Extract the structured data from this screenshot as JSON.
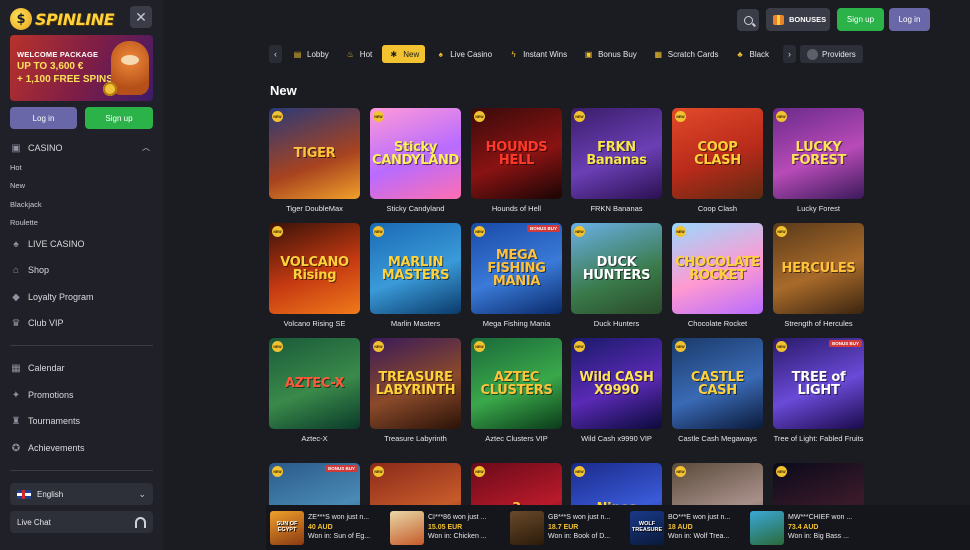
{
  "brand": {
    "name": "SPINLINE"
  },
  "sidebar": {
    "promo": {
      "line1": "WELCOME PACKAGE",
      "line2": "UP TO 3,600 €",
      "line3": "+ 1,100 FREE SPINS"
    },
    "login_label": "Log in",
    "signup_label": "Sign up",
    "casino_label": "CASINO",
    "casino_subitems": [
      "Hot",
      "New",
      "Blackjack",
      "Roulette"
    ],
    "nav": [
      {
        "label": "LIVE CASINO",
        "icon": "live-casino-icon"
      },
      {
        "label": "Shop",
        "icon": "shop-icon"
      },
      {
        "label": "Loyalty Program",
        "icon": "loyalty-icon"
      },
      {
        "label": "Club VIP",
        "icon": "crown-icon"
      }
    ],
    "nav2": [
      {
        "label": "Calendar",
        "icon": "calendar-icon"
      },
      {
        "label": "Promotions",
        "icon": "promotions-icon"
      },
      {
        "label": "Tournaments",
        "icon": "trophy-icon"
      },
      {
        "label": "Achievements",
        "icon": "achievements-icon"
      }
    ],
    "language": "English",
    "live_chat": "Live Chat"
  },
  "header": {
    "bonuses_label": "BONUSES",
    "signup_label": "Sign up",
    "login_label": "Log in"
  },
  "categories": [
    {
      "label": "Lobby",
      "icon": "lobby-icon",
      "active": false
    },
    {
      "label": "Hot",
      "icon": "flame-icon",
      "active": false
    },
    {
      "label": "New",
      "icon": "new-icon",
      "active": true
    },
    {
      "label": "Live Casino",
      "icon": "live-casino-icon",
      "active": false
    },
    {
      "label": "Instant Wins",
      "icon": "lightning-icon",
      "active": false
    },
    {
      "label": "Bonus Buy",
      "icon": "bonus-buy-icon",
      "active": false
    },
    {
      "label": "Scratch Cards",
      "icon": "scratch-card-icon",
      "active": false
    },
    {
      "label": "Black",
      "icon": "blackjack-icon",
      "active": false
    }
  ],
  "providers_label": "Providers",
  "section_title": "New",
  "badges": {
    "new": "NEW",
    "bonus_buy": "BONUS BUY"
  },
  "games": [
    {
      "name": "Tiger DoubleMax",
      "art": "TIGER",
      "bg": "linear-gradient(160deg,#2b3a78,#a8431f 60%,#f0a02a)",
      "fg": "#ffc23a",
      "bonus": false
    },
    {
      "name": "Sticky Candyland",
      "art": "Sticky CANDYLAND",
      "bg": "linear-gradient(160deg,#ff9ad8,#b86bff 55%,#ff6fb0)",
      "fg": "#ffef5a",
      "bonus": false
    },
    {
      "name": "Hounds of Hell",
      "art": "HOUNDS HELL",
      "bg": "linear-gradient(160deg,#3a0a0a,#8a1313 55%,#1a0505)",
      "fg": "#ff3a2a",
      "bonus": false
    },
    {
      "name": "FRKN Bananas",
      "art": "FRKN Bananas",
      "bg": "linear-gradient(160deg,#3a1d6a,#6b3fb5 55%,#2a1050)",
      "fg": "#f6e64a",
      "bonus": false
    },
    {
      "name": "Coop Clash",
      "art": "COOP CLASH",
      "bg": "linear-gradient(160deg,#e24a2a,#b82a1a 55%,#5c2a12)",
      "fg": "#ffd23a",
      "bonus": false
    },
    {
      "name": "Lucky Forest",
      "art": "LUCKY FOREST",
      "bg": "linear-gradient(160deg,#6a2a8a,#b84bb8 55%,#3a1a5a)",
      "fg": "#ffe15a",
      "bonus": false
    },
    {
      "name": "Volcano Rising SE",
      "art": "VOLCANO Rising",
      "bg": "linear-gradient(160deg,#3a1208,#c63a12 55%,#f07a1a)",
      "fg": "#ffd23a",
      "bonus": false
    },
    {
      "name": "Marlin Masters",
      "art": "MARLIN MASTERS",
      "bg": "linear-gradient(160deg,#1a6ab5,#3a9ad8 55%,#0a3a6a)",
      "fg": "#ffd23a",
      "bonus": false
    },
    {
      "name": "Mega Fishing Mania",
      "art": "MEGA FISHING MANIA",
      "bg": "linear-gradient(160deg,#1a4aa8,#3a7ad8 55%,#0a2a6a)",
      "fg": "#ffc23a",
      "bonus": true
    },
    {
      "name": "Duck Hunters",
      "art": "DUCK HUNTERS",
      "bg": "linear-gradient(160deg,#6ab0e8,#3a7a4a 60%,#2a4a2a)",
      "fg": "#ffffff",
      "bonus": false
    },
    {
      "name": "Chocolate Rocket",
      "art": "CHOCOLATE ROCKET",
      "bg": "linear-gradient(160deg,#9ad8ff,#ff9ad0 55%,#b86bff)",
      "fg": "#ffd23a",
      "bonus": false
    },
    {
      "name": "Strength of Hercules",
      "art": "HERCULES",
      "bg": "linear-gradient(160deg,#5a3a1a,#a86a2a 55%,#3a2410)",
      "fg": "#ffc23a",
      "bonus": false
    },
    {
      "name": "Aztec-X",
      "art": "AZTEC-X",
      "bg": "linear-gradient(160deg,#1a5a3a,#3a8a4a 55%,#0a3a2a)",
      "fg": "#ff5a3a",
      "bonus": false
    },
    {
      "name": "Treasure Labyrinth",
      "art": "TREASURE LABYRINTH",
      "bg": "linear-gradient(160deg,#3a1a5a,#8a4a2a 55%,#2a1208)",
      "fg": "#ffd23a",
      "bonus": false
    },
    {
      "name": "Aztec Clusters VIP",
      "art": "AZTEC CLUSTERS",
      "bg": "linear-gradient(160deg,#1a6a3a,#3aa84a 55%,#0a3a1a)",
      "fg": "#ffc23a",
      "bonus": false
    },
    {
      "name": "Wild Cash x9990 VIP",
      "art": "Wild CASH X9990",
      "bg": "linear-gradient(160deg,#1a1a6a,#5a2ab5 55%,#0a0a3a)",
      "fg": "#ffe15a",
      "bonus": false
    },
    {
      "name": "Castle Cash Megaways",
      "art": "CASTLE CASH",
      "bg": "linear-gradient(160deg,#1a3a6a,#3a6ab5 55%,#0a1a3a)",
      "fg": "#ffd23a",
      "bonus": false
    },
    {
      "name": "Tree of Light: Fabled Fruits",
      "art": "TREE of LIGHT",
      "bg": "linear-gradient(160deg,#2a1a6a,#6a4ad8 55%,#1a0a4a)",
      "fg": "#ffffff",
      "bonus": true
    },
    {
      "name": "",
      "art": "",
      "bg": "linear-gradient(160deg,#2a5a8a,#4a8ab5 55%,#1a3a5a)",
      "fg": "#ffd23a",
      "bonus": true
    },
    {
      "name": "",
      "art": "",
      "bg": "linear-gradient(160deg,#8a2a1a,#c65a2a 55%,#3a1208)",
      "fg": "#ffd23a",
      "bonus": false
    },
    {
      "name": "",
      "art": "3",
      "bg": "linear-gradient(160deg,#6a0a1a,#b81a2a 55%,#3a0510)",
      "fg": "#ffc23a",
      "bonus": false
    },
    {
      "name": "",
      "art": "Nines",
      "bg": "linear-gradient(160deg,#1a2a8a,#3a5ad8 55%,#0a1a5a)",
      "fg": "#ffd23a",
      "bonus": false
    },
    {
      "name": "",
      "art": "",
      "bg": "linear-gradient(160deg,#5a4a3a,#a8908a 55%,#3a2a2a)",
      "fg": "#ffffff",
      "bonus": false
    },
    {
      "name": "",
      "art": "",
      "bg": "linear-gradient(160deg,#0a0a1a,#3a1a2a 55%,#1a0a0a)",
      "fg": "#ff3a3a",
      "bonus": false
    }
  ],
  "ticker": [
    {
      "user": "ZE***S won just n...",
      "amount": "40 AUD",
      "game": "Won in: Sun of Eg...",
      "art": "SUN OF EGYPT",
      "bg": "linear-gradient(160deg,#f0a02a,#8a3a12)"
    },
    {
      "user": "CI***86 won just ...",
      "amount": "15.05 EUR",
      "game": "Won in: Chicken ...",
      "art": "",
      "bg": "linear-gradient(160deg,#e8d8a8,#c65a2a)"
    },
    {
      "user": "GB***S won just n...",
      "amount": "18.7 EUR",
      "game": "Won in: Book of D...",
      "art": "",
      "bg": "linear-gradient(160deg,#6a4a2a,#2a1a0a)"
    },
    {
      "user": "BO***E won just n...",
      "amount": "18 AUD",
      "game": "Won in: Wolf Trea...",
      "art": "WOLF TREASURE",
      "bg": "linear-gradient(160deg,#1a3a8a,#0a1a3a)"
    },
    {
      "user": "MW***CHIEF won ...",
      "amount": "73.4 AUD",
      "game": "Won in: Big Bass ...",
      "art": "",
      "bg": "linear-gradient(160deg,#3aa8d8,#2a6a3a)"
    }
  ]
}
